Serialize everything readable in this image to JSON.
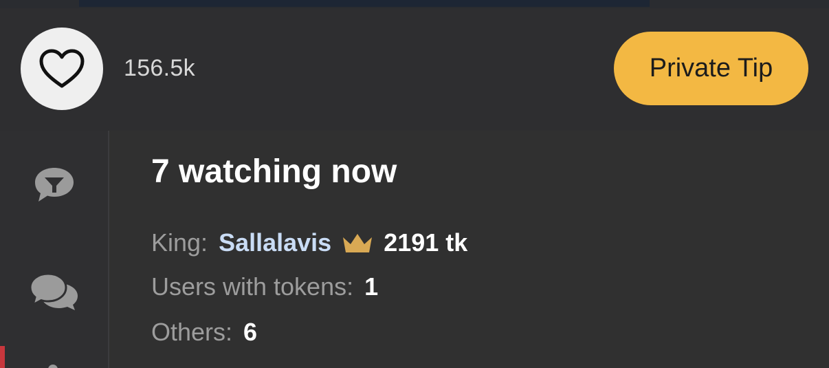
{
  "header": {
    "like_count": "156.5k",
    "private_tip_label": "Private Tip",
    "tip_color": "#f3b843"
  },
  "sidebar": {
    "tabs": [
      {
        "icon": "chat-filter-icon"
      },
      {
        "icon": "chat-bubbles-icon"
      }
    ]
  },
  "viewers": {
    "title": "7 watching now",
    "king_label": "King:",
    "king_name": "Sallalavis",
    "king_icon": "crown-icon",
    "king_tokens": "2191 tk",
    "users_with_tokens_label": "Users with tokens:",
    "users_with_tokens_value": "1",
    "others_label": "Others:",
    "others_value": "6"
  }
}
